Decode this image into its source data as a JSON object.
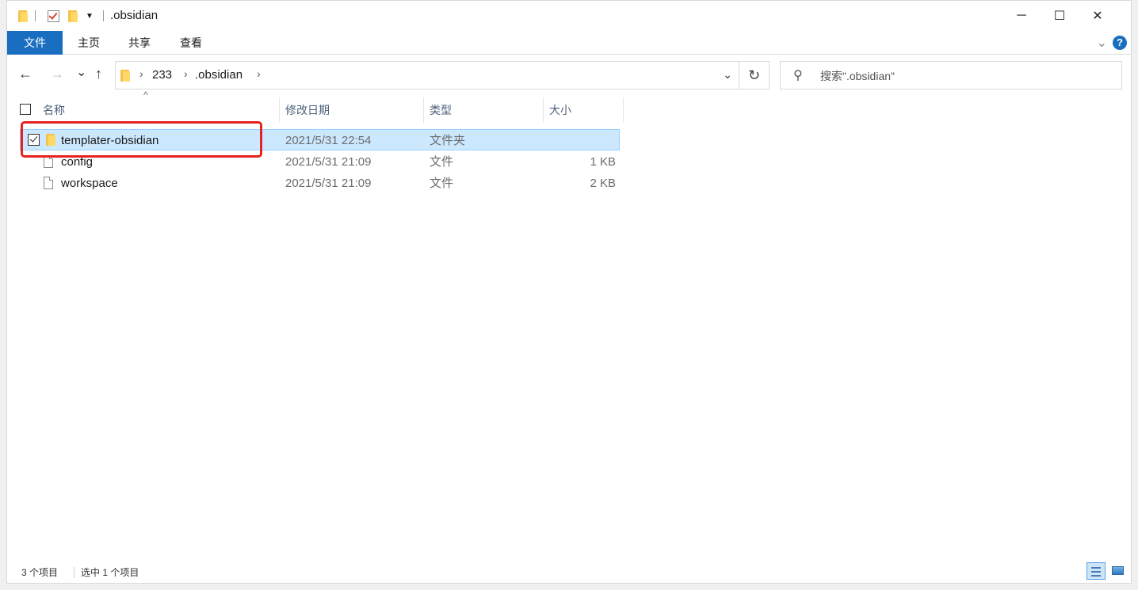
{
  "window": {
    "title": ".obsidian",
    "controls": {
      "minimize": "─",
      "maximize": "☐",
      "close": "✕"
    }
  },
  "ribbon": {
    "tabs": [
      "文件",
      "主页",
      "共享",
      "查看"
    ],
    "help": "?"
  },
  "nav": {
    "back": "←",
    "forward": "→",
    "recent": "⌄",
    "up": "↑",
    "breadcrumb": [
      "233",
      ".obsidian"
    ],
    "refresh": "↻"
  },
  "search": {
    "placeholder": "搜索\".obsidian\""
  },
  "columns": {
    "name": "名称",
    "date": "修改日期",
    "type": "类型",
    "size": "大小"
  },
  "files": [
    {
      "name": "templater-obsidian",
      "date": "2021/5/31 22:54",
      "type": "文件夹",
      "size": "",
      "icon": "folder-icon",
      "selected": true
    },
    {
      "name": "config",
      "date": "2021/5/31 21:09",
      "type": "文件",
      "size": "1 KB",
      "icon": "file-icon",
      "selected": false
    },
    {
      "name": "workspace",
      "date": "2021/5/31 21:09",
      "type": "文件",
      "size": "2 KB",
      "icon": "file-icon",
      "selected": false
    }
  ],
  "status": {
    "item_count": "3 个项目",
    "selected_count": "选中 1 个项目"
  },
  "colors": {
    "accent": "#1a6ec0",
    "selection": "#cce8ff",
    "highlight": "#e8231f"
  }
}
